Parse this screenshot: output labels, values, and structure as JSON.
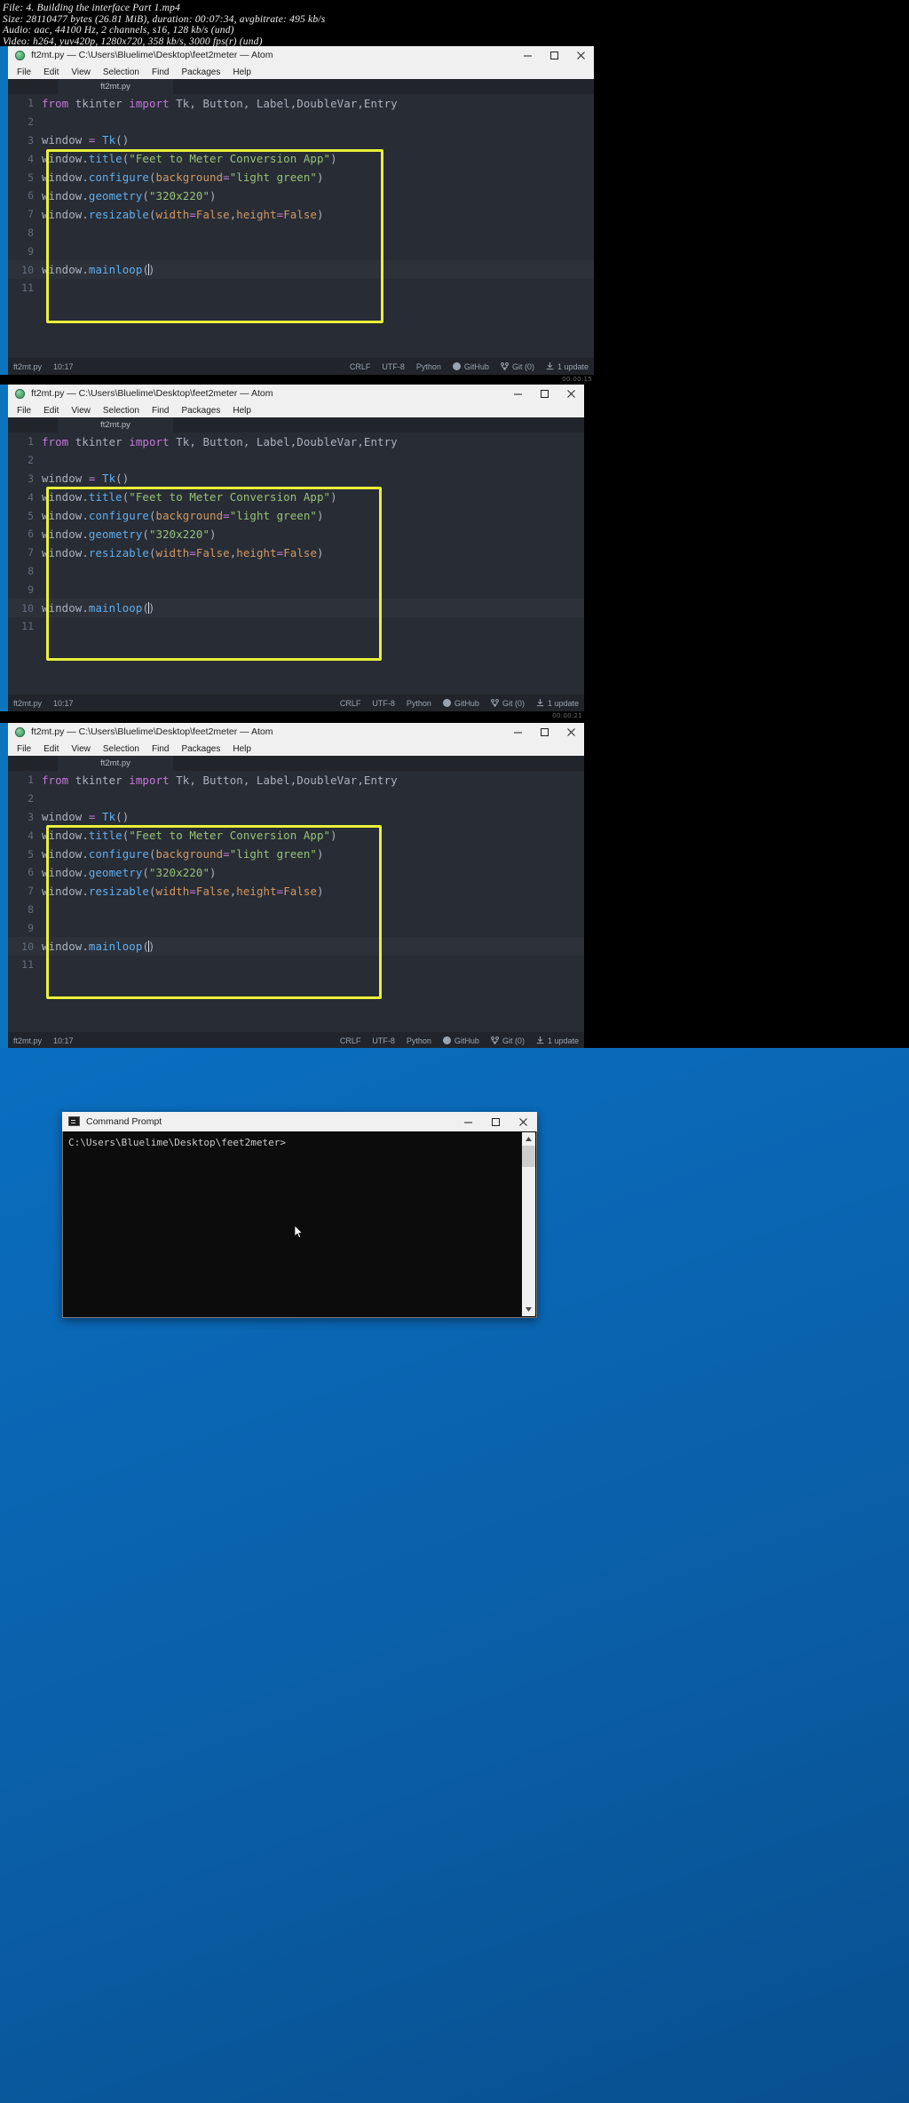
{
  "video_info": {
    "lines": [
      "File: 4. Building the interface  Part 1.mp4",
      "Size: 28110477 bytes (26.81 MiB), duration: 00:07:34, avgbitrate: 495 kb/s",
      "Audio: aac, 44100 Hz, 2 channels, s16, 128 kb/s (und)",
      "Video: h264, yuv420p, 1280x720, 358 kb/s, 3000 fps(r) (und)"
    ]
  },
  "atom": {
    "window_title": "ft2mt.py — C:\\Users\\Bluelime\\Desktop\\feet2meter — Atom",
    "app_icon": "atom-icon",
    "menu": [
      "File",
      "Edit",
      "View",
      "Selection",
      "Find",
      "Packages",
      "Help"
    ],
    "tab_label": "ft2mt.py",
    "window_buttons": {
      "minimize": "—",
      "maximize": "□",
      "close": "✕"
    },
    "lines": [
      {
        "n": "1",
        "tokens": [
          {
            "t": "from",
            "c": "k"
          },
          {
            "t": " tkinter ",
            "c": "p"
          },
          {
            "t": "import",
            "c": "k"
          },
          {
            "t": " Tk, Button, Label,DoubleVar,Entry",
            "c": "p"
          }
        ]
      },
      {
        "n": "2",
        "tokens": []
      },
      {
        "n": "3",
        "tokens": [
          {
            "t": "window ",
            "c": "p"
          },
          {
            "t": "=",
            "c": "k"
          },
          {
            "t": " ",
            "c": "p"
          },
          {
            "t": "Tk",
            "c": "f"
          },
          {
            "t": "()",
            "c": "p"
          }
        ]
      },
      {
        "n": "4",
        "tokens": [
          {
            "t": "window.",
            "c": "p"
          },
          {
            "t": "title",
            "c": "f"
          },
          {
            "t": "(",
            "c": "p"
          },
          {
            "t": "\"Feet to Meter Conversion App\"",
            "c": "s"
          },
          {
            "t": ")",
            "c": "p"
          }
        ]
      },
      {
        "n": "5",
        "tokens": [
          {
            "t": "window.",
            "c": "p"
          },
          {
            "t": "configure",
            "c": "f"
          },
          {
            "t": "(",
            "c": "p"
          },
          {
            "t": "background",
            "c": "a"
          },
          {
            "t": "=",
            "c": "k"
          },
          {
            "t": "\"light green\"",
            "c": "s"
          },
          {
            "t": ")",
            "c": "p"
          }
        ]
      },
      {
        "n": "6",
        "tokens": [
          {
            "t": "window.",
            "c": "p"
          },
          {
            "t": "geometry",
            "c": "f"
          },
          {
            "t": "(",
            "c": "p"
          },
          {
            "t": "\"320x220\"",
            "c": "s"
          },
          {
            "t": ")",
            "c": "p"
          }
        ]
      },
      {
        "n": "7",
        "tokens": [
          {
            "t": "window.",
            "c": "p"
          },
          {
            "t": "resizable",
            "c": "f"
          },
          {
            "t": "(",
            "c": "p"
          },
          {
            "t": "width",
            "c": "a"
          },
          {
            "t": "=",
            "c": "k"
          },
          {
            "t": "False",
            "c": "a"
          },
          {
            "t": ",",
            "c": "p"
          },
          {
            "t": "height",
            "c": "a"
          },
          {
            "t": "=",
            "c": "k"
          },
          {
            "t": "False",
            "c": "a"
          },
          {
            "t": ")",
            "c": "p"
          }
        ]
      },
      {
        "n": "8",
        "tokens": []
      },
      {
        "n": "9",
        "tokens": []
      },
      {
        "n": "10",
        "tokens": [
          {
            "t": "window.",
            "c": "p"
          },
          {
            "t": "mainloop",
            "c": "f"
          },
          {
            "t": "(",
            "c": "p"
          },
          {
            "t": "|",
            "c": "caret"
          },
          {
            "t": ")",
            "c": "p"
          }
        ]
      },
      {
        "n": "11",
        "tokens": []
      }
    ],
    "status": {
      "file": "ft2mt.py",
      "position": "10:17",
      "line_ending": "CRLF",
      "encoding": "UTF-8",
      "grammar": "Python",
      "github": "GitHub",
      "git": "Git (0)",
      "updates": "1 update"
    },
    "watermark": "00:00:15"
  },
  "atom_watermarks": [
    "00:00:15",
    "00:00:21",
    "00:00:21"
  ],
  "command_prompt": {
    "title": "Command Prompt",
    "icon": "console-icon",
    "prompt_text": "C:\\Users\\Bluelime\\Desktop\\feet2meter>",
    "window_buttons": {
      "minimize": "—",
      "maximize": "□",
      "close": "✕"
    },
    "scrollbar": {
      "up": "▲",
      "down": "▼"
    }
  },
  "colors": {
    "desktop_blue": "#0a65b0",
    "highlight_yellow": "#e8f03a",
    "editor_bg": "#282c34",
    "titlebar_bg": "#f0f0f0"
  }
}
